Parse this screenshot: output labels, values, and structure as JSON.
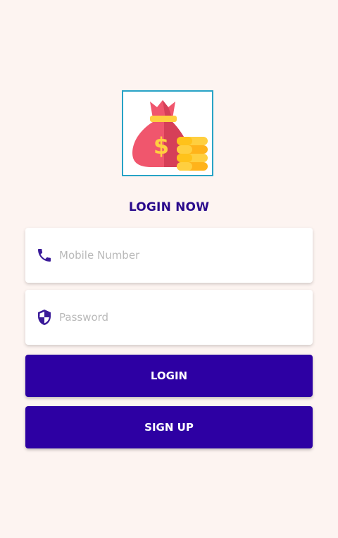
{
  "logo": {
    "icon": "money-bag-coins-icon"
  },
  "page_title": "LOGIN NOW",
  "form": {
    "mobile": {
      "icon": "phone-icon",
      "placeholder": "Mobile Number",
      "value": ""
    },
    "password": {
      "icon": "shield-icon",
      "placeholder": "Password",
      "value": ""
    }
  },
  "buttons": {
    "login_label": "LOGIN",
    "signup_label": "SIGN UP"
  },
  "colors": {
    "background": "#fdf4f1",
    "title": "#2a0a8c",
    "button": "#2d00a3",
    "logo_border": "#27a3c6",
    "field_icon": "#3a1a99"
  }
}
